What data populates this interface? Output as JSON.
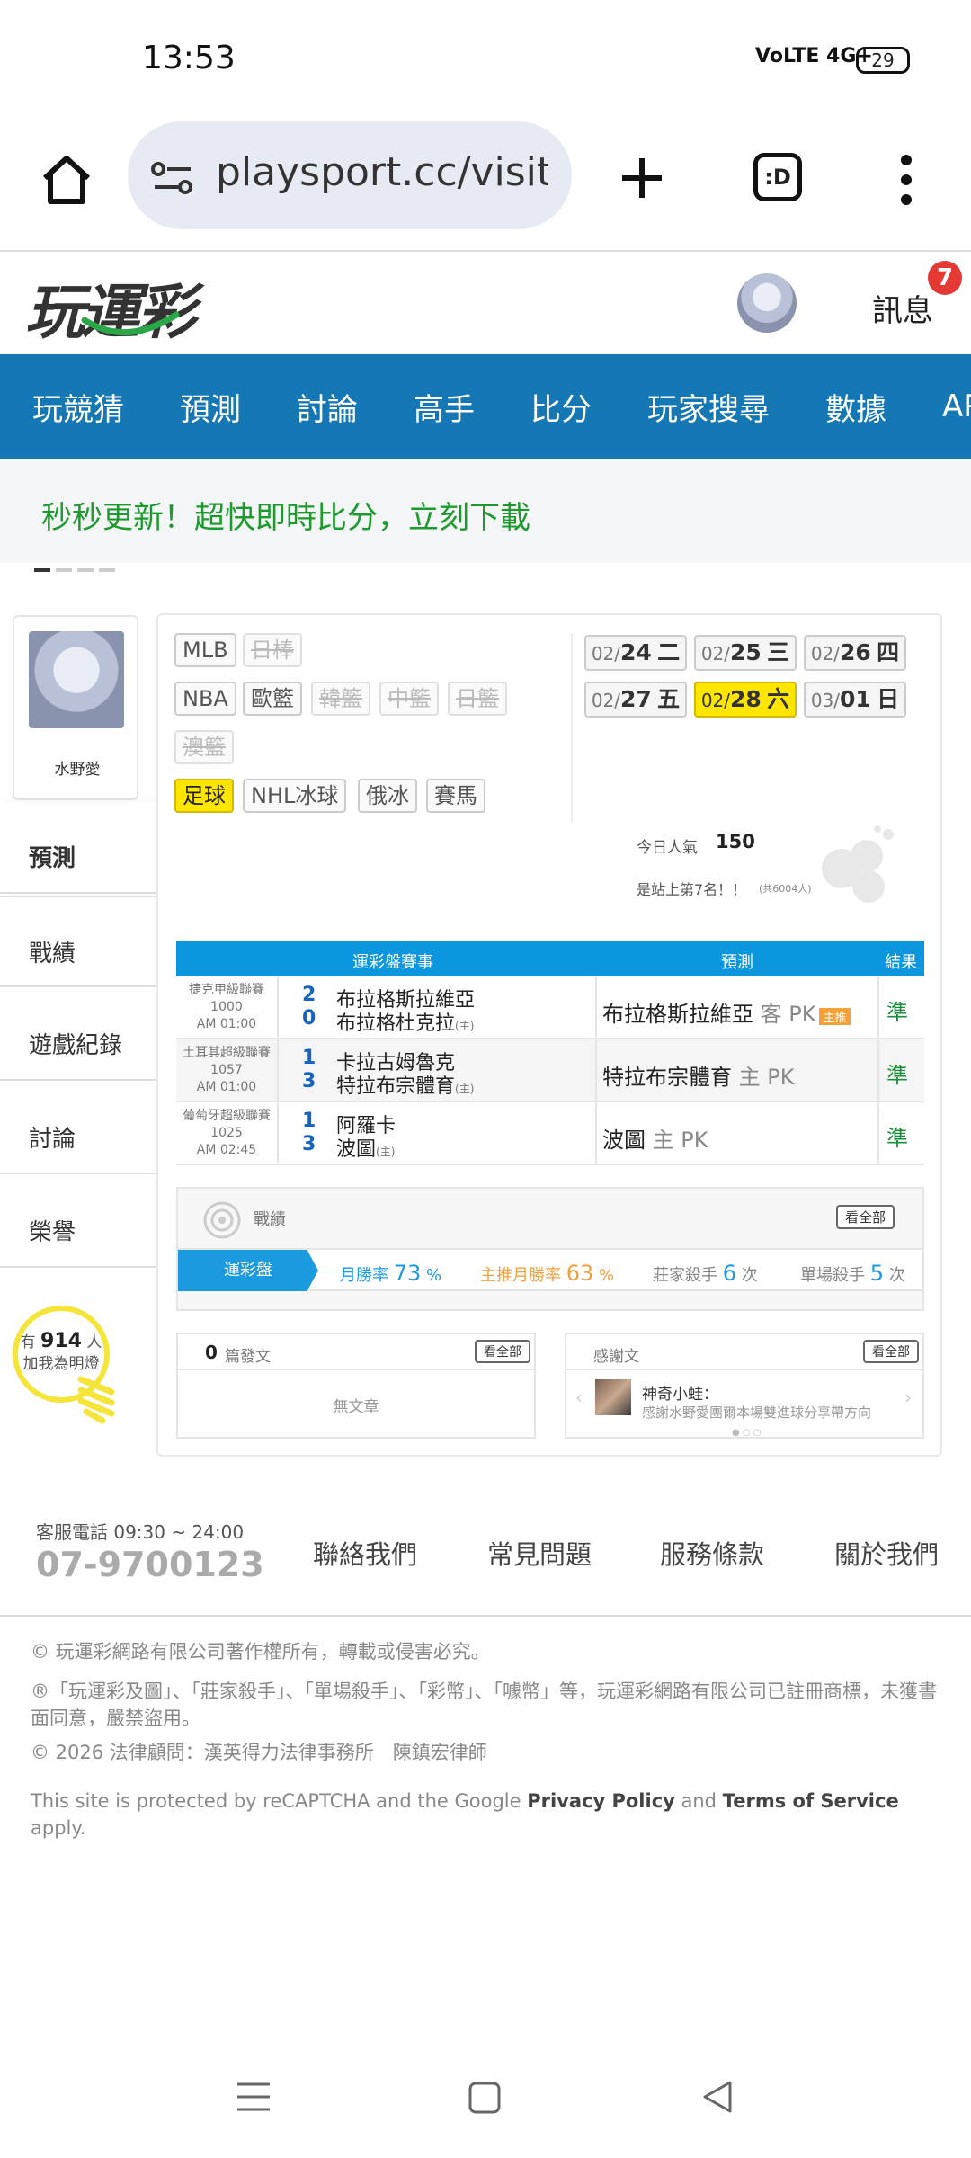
{
  "status": {
    "time": "13:53",
    "signal": "VoLTE 4G+",
    "battery": "29"
  },
  "browser": {
    "url": "playsport.cc/visit",
    "tab_label": ":D",
    "home_icon": "home-icon",
    "add_icon": "plus-icon",
    "menu_icon": "more-vertical-icon"
  },
  "header": {
    "logo": "玩運彩",
    "messages_label": "訊息",
    "messages_badge": "7"
  },
  "nav": {
    "items": [
      "玩競猜",
      "預測",
      "討論",
      "高手",
      "比分",
      "玩家搜尋",
      "數據",
      "APP"
    ]
  },
  "banner": {
    "text": "秒秒更新！超快即時比分，立刻下載"
  },
  "profile": {
    "name": "水野愛"
  },
  "side_menu": [
    "預測",
    "戰績",
    "遊戲紀錄",
    "討論",
    "榮譽"
  ],
  "leagues": {
    "row1": [
      {
        "label": "MLB",
        "state": "normal"
      },
      {
        "label": "日棒",
        "state": "disabled"
      }
    ],
    "row2": [
      {
        "label": "NBA",
        "state": "normal"
      },
      {
        "label": "歐籃",
        "state": "normal"
      },
      {
        "label": "韓籃",
        "state": "disabled"
      },
      {
        "label": "中籃",
        "state": "disabled"
      },
      {
        "label": "日籃",
        "state": "disabled"
      }
    ],
    "row3": [
      {
        "label": "澳籃",
        "state": "disabled"
      }
    ],
    "row4": [
      {
        "label": "足球",
        "state": "selected"
      },
      {
        "label": "NHL冰球",
        "state": "normal"
      },
      {
        "label": "俄冰",
        "state": "normal"
      },
      {
        "label": "賽馬",
        "state": "normal"
      }
    ]
  },
  "dates": [
    {
      "md": "02/",
      "day": "24",
      "wd": "二"
    },
    {
      "md": "02/",
      "day": "25",
      "wd": "三"
    },
    {
      "md": "02/",
      "day": "26",
      "wd": "四"
    },
    {
      "md": "02/",
      "day": "27",
      "wd": "五"
    },
    {
      "md": "02/",
      "day": "28",
      "wd": "六",
      "selected": true
    },
    {
      "md": "03/",
      "day": "01",
      "wd": "日"
    }
  ],
  "popularity": {
    "label": "今日人氣",
    "value": "150",
    "rank": "是站上第7名！！",
    "total": "(共6004人)"
  },
  "table": {
    "headers": [
      "運彩盤賽事",
      "預測",
      "結果"
    ],
    "rows": [
      {
        "league": "捷克甲級聯賽",
        "code": "1000",
        "time": "AM 01:00",
        "s1": "2",
        "s2": "0",
        "t1": "布拉格斯拉維亞",
        "t2": "布拉格杜克拉",
        "home": "(主)",
        "pick": "布拉格斯拉維亞",
        "pk": "客 PK",
        "hot": "主推",
        "result": "準"
      },
      {
        "league": "土耳其超級聯賽",
        "code": "1057",
        "time": "AM 01:00",
        "s1": "1",
        "s2": "3",
        "t1": "卡拉古姆魯克",
        "t2": "特拉布宗體育",
        "home": "(主)",
        "pick": "特拉布宗體育",
        "pk": "主 PK",
        "hot": "",
        "result": "準"
      },
      {
        "league": "葡萄牙超級聯賽",
        "code": "1025",
        "time": "AM 02:45",
        "s1": "1",
        "s2": "3",
        "t1": "阿羅卡",
        "t2": "波圖",
        "home": "(主)",
        "pick": "波圖",
        "pk": "主 PK",
        "hot": "",
        "result": "準"
      }
    ]
  },
  "record": {
    "title": "戰績",
    "see_all": "看全部",
    "tab": "運彩盤",
    "monthly_win_label": "月勝率",
    "monthly_win": "73",
    "pct": "%",
    "main_win_label": "主推月勝率",
    "main_win": "63",
    "banker_label": "莊家殺手",
    "banker": "6",
    "times": "次",
    "single_label": "單場殺手",
    "single": "5"
  },
  "posts": {
    "count": "0",
    "label": "篇發文",
    "see_all": "看全部",
    "empty": "無文章"
  },
  "thanks": {
    "title": "感謝文",
    "see_all": "看全部",
    "user": "神奇小蛙：",
    "text": "感謝水野愛團爾本場雙進球分享帶方向"
  },
  "online": {
    "prefix": "有",
    "count": "914",
    "suffix": "人",
    "line2": "加我為明燈"
  },
  "footer": {
    "hours": "客服電話 09:30 ~ 24:00",
    "phone": "07-9700123",
    "links": [
      "聯絡我們",
      "常見問題",
      "服務條款",
      "關於我們"
    ],
    "copyright": "© 玩運彩網路有限公司著作權所有，轉載或侵害必究。",
    "trademark": "®「玩運彩及圖」、「莊家殺手」、「單場殺手」、「彩幣」、「噱幣」等，玩運彩網路有限公司已註冊商標，未獲書面同意，嚴禁盜用。",
    "legal": "© 2026 法律顧問：漢英得力法律事務所　陳鎮宏律師",
    "recaptcha_pre": "This site is protected by reCAPTCHA and the Google ",
    "privacy": "Privacy Policy",
    "and": " and ",
    "terms": "Terms of Service",
    "apply": " apply."
  }
}
